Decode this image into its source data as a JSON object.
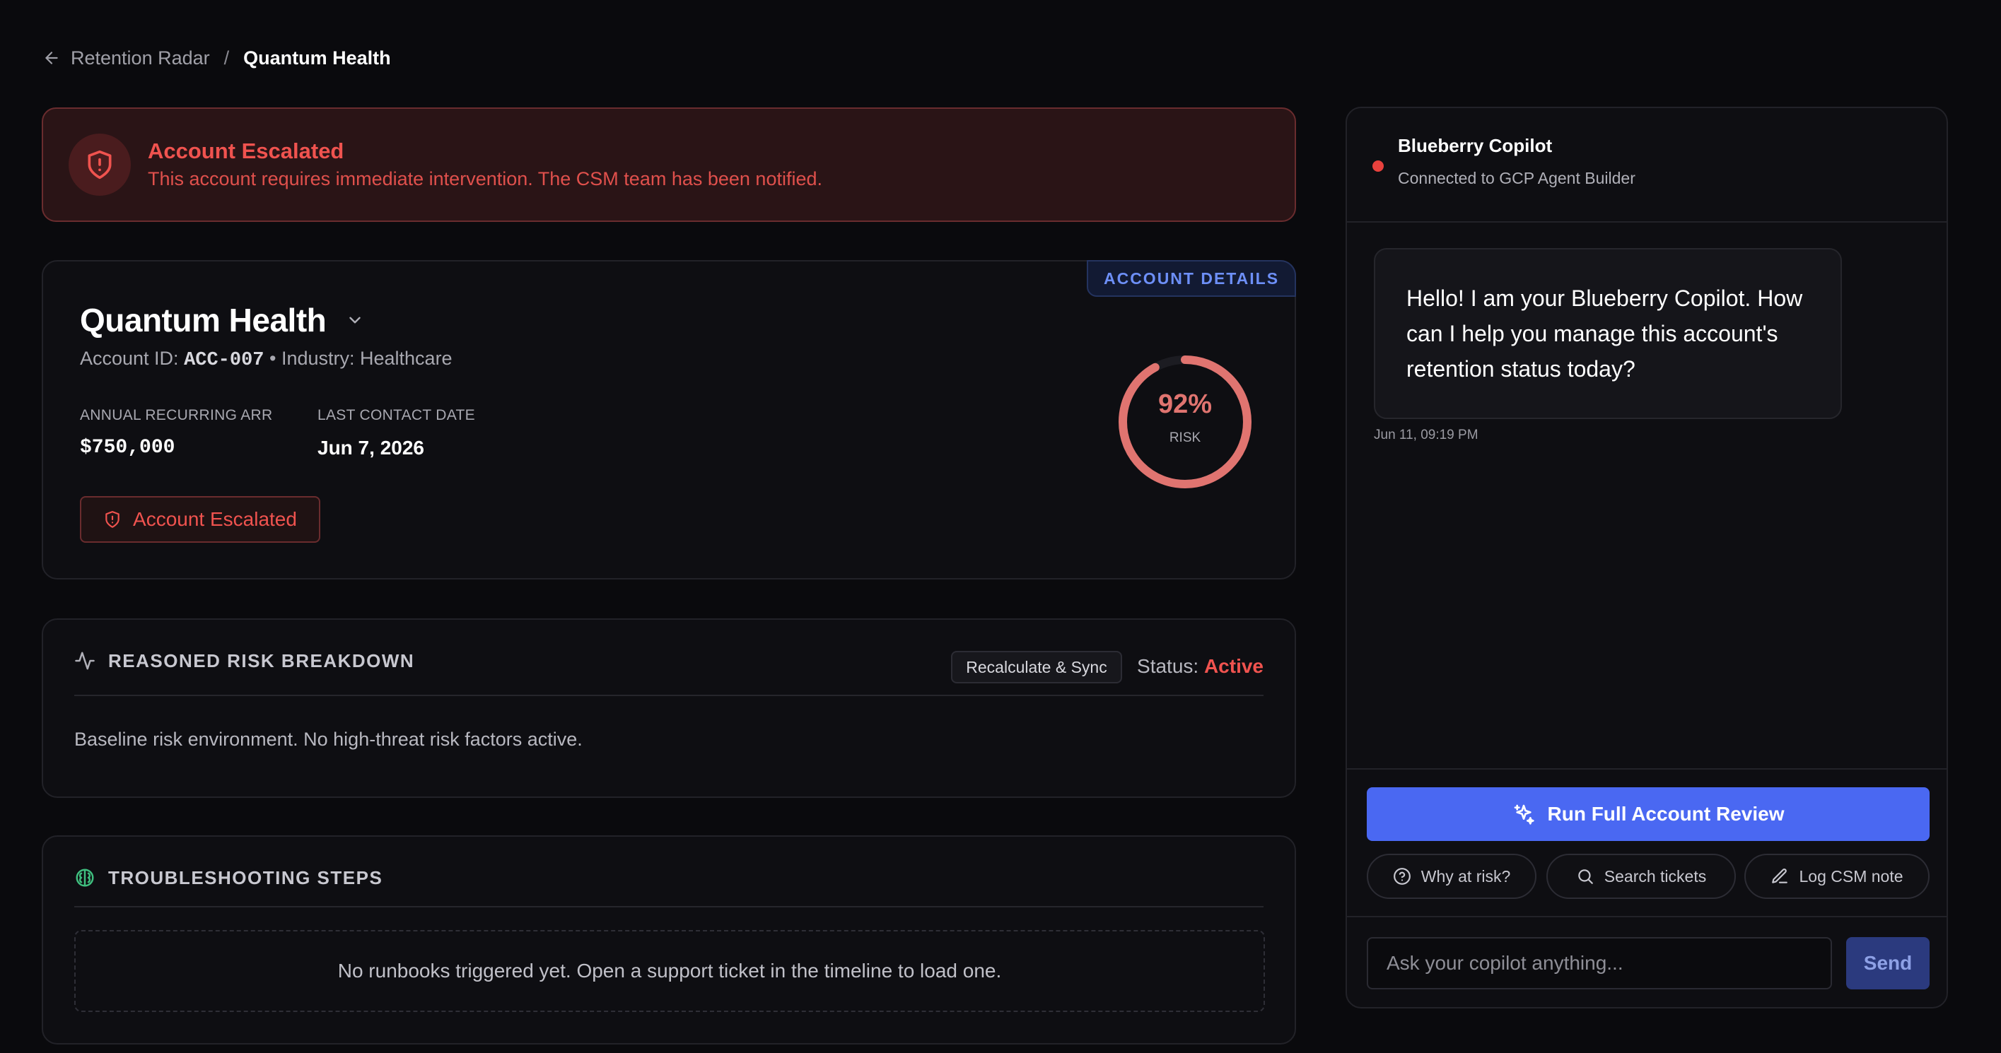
{
  "breadcrumb": {
    "parent": "Retention Radar",
    "separator": "/",
    "current": "Quantum Health"
  },
  "banner": {
    "title": "Account Escalated",
    "message": "This account requires immediate intervention. The CSM team has been notified."
  },
  "account": {
    "details_tab": "ACCOUNT DETAILS",
    "name": "Quantum Health",
    "id_label": "Account ID: ",
    "id": "ACC-007",
    "industry": " • Industry: Healthcare",
    "arr_label": "ANNUAL RECURRING ARR",
    "arr_value": "$750,000",
    "contact_label": "LAST CONTACT DATE",
    "contact_value": "Jun 7, 2026",
    "escalated_label": "Account Escalated",
    "risk_percent": 92,
    "risk_text": "92%",
    "risk_label": "RISK"
  },
  "risk_breakdown": {
    "title": "REASONED RISK BREAKDOWN",
    "recalc_label": "Recalculate & Sync",
    "status_label": "Status: ",
    "status_value": "Active",
    "body": "Baseline risk environment. No high-threat risk factors active."
  },
  "troubleshooting": {
    "title": "TROUBLESHOOTING STEPS",
    "empty": "No runbooks triggered yet. Open a support ticket in the timeline to load one."
  },
  "copilot": {
    "title": "Blueberry Copilot",
    "subtitle": "Connected to GCP Agent Builder",
    "message": "Hello! I am your Blueberry Copilot. How can I help you manage this account's retention status today?",
    "message_time": "Jun 11, 09:19 PM",
    "run_review": "Run Full Account Review",
    "chips": [
      "Why at risk?",
      "Search tickets",
      "Log CSM note"
    ],
    "input_placeholder": "Ask your copilot anything...",
    "send": "Send"
  },
  "colors": {
    "accent_blue": "#4a68f2",
    "danger": "#f0534f",
    "gauge": "#e07470",
    "background": "#0a0a0d"
  },
  "icons": {
    "back": "arrow-left-icon",
    "shield": "shield-alert-icon",
    "chevron": "chevron-down-icon",
    "activity": "activity-icon",
    "brain": "brain-icon",
    "sparkle": "sparkles-icon",
    "help": "help-circle-icon",
    "search": "search-icon",
    "pen": "pen-icon"
  }
}
